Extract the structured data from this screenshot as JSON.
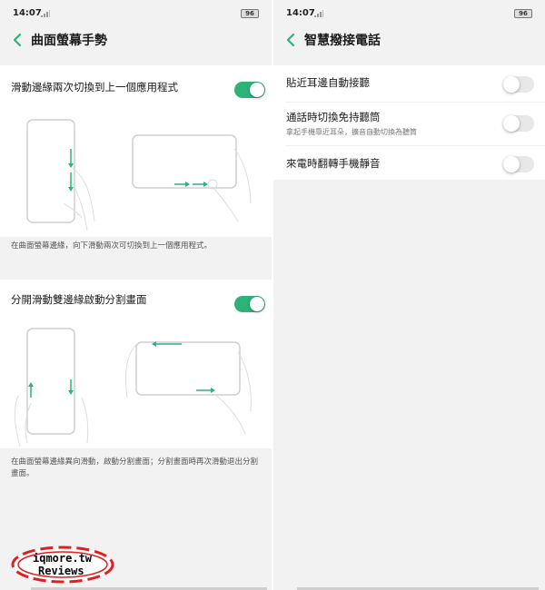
{
  "left_screen": {
    "status": {
      "time": "14:07",
      "battery": "96"
    },
    "title": "曲面螢幕手勢",
    "sections": [
      {
        "label": "滑動邊緣兩次切換到上一個應用程式",
        "toggle": "on",
        "description": "在曲面螢幕邊緣，向下滑動兩次可切換到上一個應用程式。"
      },
      {
        "label": "分開滑動雙邊緣啟動分割畫面",
        "toggle": "on",
        "description": "在曲面螢幕邊緣異向滑動，啟動分割畫面；分割畫面時再次滑動退出分割畫面。"
      }
    ]
  },
  "right_screen": {
    "status": {
      "time": "14:07",
      "battery": "96"
    },
    "title": "智慧撥接電話",
    "settings": [
      {
        "label": "貼近耳邊自動接聽",
        "subtitle": "",
        "toggle": "off"
      },
      {
        "label": "通話時切換免持聽筒",
        "subtitle": "拿起手機靠近耳朵，擴音自動切換為聽筒",
        "toggle": "off"
      },
      {
        "label": "來電時翻轉手機靜音",
        "subtitle": "",
        "toggle": "off"
      }
    ]
  },
  "watermark": {
    "line1": "iqmore.tw",
    "line2": "Reviews"
  },
  "colors": {
    "accent": "#2eb27a",
    "background": "#f2f2f2",
    "card": "#ffffff",
    "watermark_ring": "#e02020"
  }
}
